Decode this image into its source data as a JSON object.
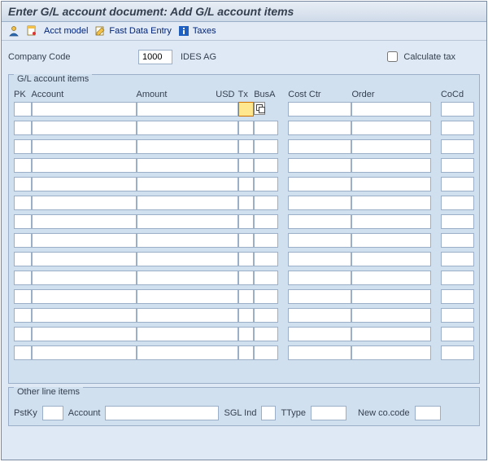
{
  "title": "Enter G/L account document: Add G/L account items",
  "toolbar": {
    "acct_model": "Acct model",
    "fast_data_entry": "Fast Data Entry",
    "taxes": "Taxes"
  },
  "header": {
    "company_code_label": "Company Code",
    "company_code_value": "1000",
    "company_name": "IDES AG",
    "calc_tax_label": "Calculate tax",
    "calc_tax_checked": false
  },
  "grid": {
    "title": "G/L account items",
    "columns": {
      "pk": "PK",
      "account": "Account",
      "amount": "Amount",
      "usd": "USD",
      "tx": "Tx",
      "busa": "BusA",
      "cost_ctr": "Cost Ctr",
      "order": "Order",
      "cocd": "CoCd"
    },
    "row_count": 14
  },
  "other": {
    "title": "Other line items",
    "pstky": "PstKy",
    "account": "Account",
    "sgl_ind": "SGL Ind",
    "ttype": "TType",
    "new_cocode": "New co.code"
  }
}
